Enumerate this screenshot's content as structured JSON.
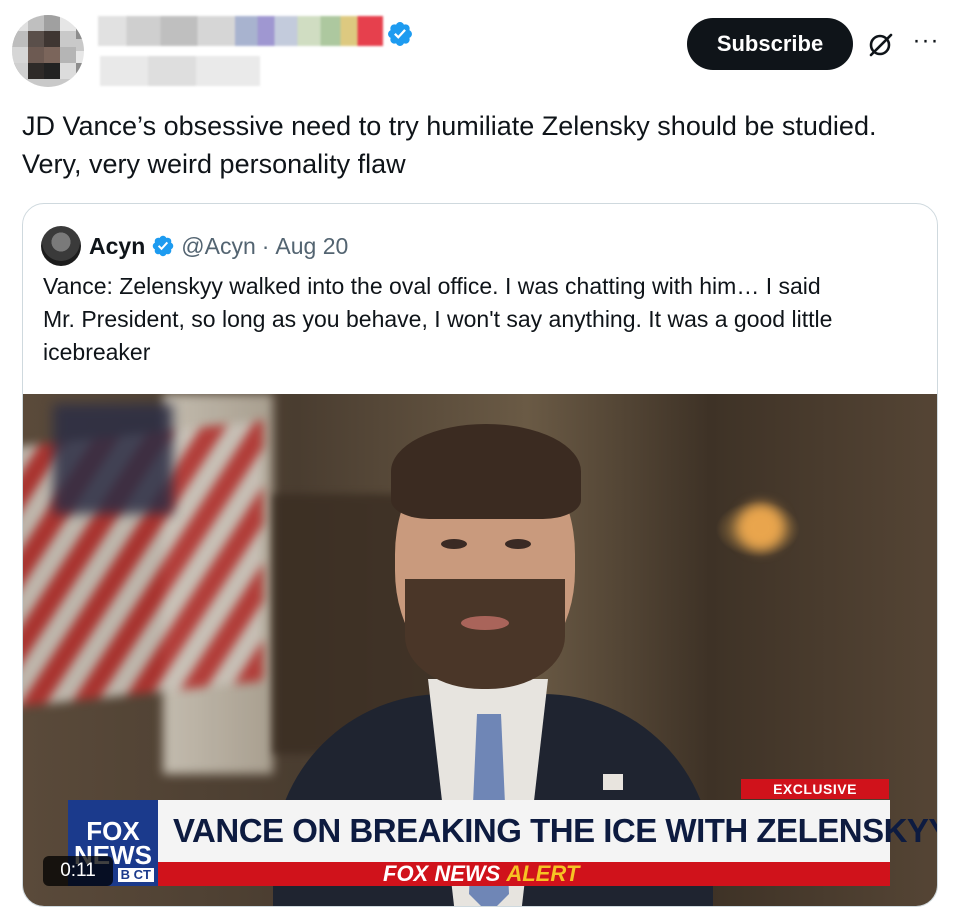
{
  "header": {
    "subscribe_label": "Subscribe",
    "more_label": "···"
  },
  "tweet": {
    "text_lines": [
      "JD Vance’s obsessive need to try humiliate Zelensky should be studied.",
      "Very, very weird personality flaw"
    ]
  },
  "quote": {
    "author_name": "Acyn",
    "handle": "@Acyn",
    "separator": "·",
    "date": "Aug 20",
    "text_lines": [
      "Vance: Zelenskyy walked into the oval office. I was chatting with him… I said",
      "Mr. President, so long as you behave, I won't say anything. It was a good little",
      "icebreaker"
    ]
  },
  "video": {
    "timestamp": "0:11",
    "exclusive_tag": "EXCLUSIVE",
    "chyron_headline": "VANCE ON BREAKING THE ICE WITH ZELENSKYY",
    "alert_prefix": "FOX NEWS",
    "alert_word": "ALERT",
    "logo_line1": "FOX",
    "logo_line2": "NEWS",
    "logo_tz": "B CT"
  },
  "colors": {
    "verified_blue": "#1d9bf0",
    "subscribe_bg": "#0f1419",
    "fox_red": "#d0121b",
    "fox_blue": "#1b3a8c",
    "alert_yellow": "#f6c324"
  },
  "icons": {
    "verified": "verified-badge-icon",
    "grok": "grok-icon",
    "more": "more-icon"
  }
}
